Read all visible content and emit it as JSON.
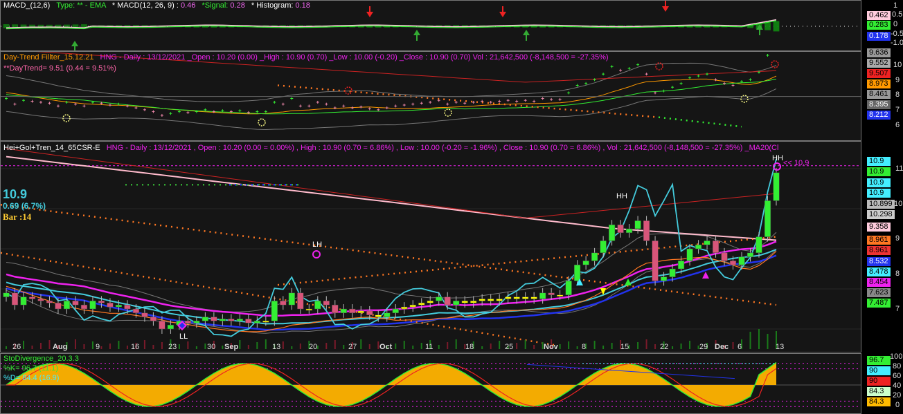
{
  "colors": {
    "up": "#33ee33",
    "down": "#d9557a",
    "neutral": "#ffff00",
    "cyan": "#44ccdd",
    "magenta": "#ee22ee",
    "blue": "#2233ee",
    "pink": "#ffbbcc"
  },
  "macd": {
    "title": "MACD_(12,6)",
    "type_label": "Type: ** - EMA",
    "macd_label": "* MACD(12, 26, 9) :",
    "macd_val": "0.46",
    "signal_label": "*Signal:",
    "signal_val": "0.28",
    "hist_label": "* Histogram:",
    "hist_val": "0.18",
    "axis_ticks": [
      "1",
      "0.5",
      "0",
      "-0.5",
      "-1.0"
    ],
    "tags": [
      "0.462",
      "0.283",
      "0.178"
    ]
  },
  "daytrend": {
    "title": "Day-Trend Fillter_15.12.21",
    "hdr_rest": "HNG - Daily : 13/12/2021 _Open : 10.20 (0.00) _High : 10.90 (0.70) _Low : 10.00 (-0.20) _Close : 10.90 (0.70) Vol : 21,642,500 (-8,148,500 = -27.35%)",
    "dt_label": "**DayTrend= 9.51 (0.44 = 9.51%)",
    "axis_ticks": [
      "10",
      "9",
      "8",
      "7",
      "6"
    ],
    "tags": [
      "9.636",
      "9.552",
      "9.507",
      "8.973",
      "8.461",
      "8.395",
      "8.212"
    ]
  },
  "main": {
    "title": "Hei+Gol+Tren_14_65CSR-E",
    "hdr_rest": "HNG - Daily : 13/12/2021 , Open : 10.20 (0.00 = 0.00%) , High : 10.90 (0.70 = 6.86%) , Low : 10.00 (-0.20 = -1.96%) , Close : 10.90 (0.70 = 6.86%) , Vol : 21,642,500 (-8,148,500 = -27.35%) _MA20(Cl",
    "price_big": "10.9",
    "price_change": "0.69 (6.7%)",
    "bar_count": "Bar :14",
    "axis_ticks": [
      "11",
      "10",
      "9",
      "8",
      "7"
    ],
    "tags": [
      "10.9",
      "10.9",
      "10.9",
      "10.9",
      "10.899",
      "10.298",
      "9.358",
      "8.961",
      "8.961",
      "8.532",
      "8.478",
      "8.454",
      "7.623",
      "7.487"
    ],
    "annotations": {
      "ll": "LL",
      "lh": "LH",
      "hh1": "HH",
      "hh2": "HH",
      "last": "<< 10.9"
    },
    "x_labels": [
      "26",
      "Aug",
      "9",
      "16",
      "23",
      "30",
      "Sep",
      "13",
      "20",
      "27",
      "Oct",
      "11",
      "18",
      "25",
      "Nov",
      "8",
      "15",
      "22",
      "29",
      "Dec",
      "6",
      "13"
    ]
  },
  "sto": {
    "title": "StoDivergence_20.3.3",
    "k_label": "%K= 96.7 (11.1)",
    "d_label": "%D= 84.4 (16.9)",
    "axis_ticks": [
      "100",
      "80",
      "60",
      "40",
      "20",
      "0"
    ],
    "tags": [
      "96.7",
      "90",
      "90",
      "84.3",
      "84.3"
    ]
  },
  "chart_data": {
    "type": "candlestick",
    "symbol": "HNG",
    "interval": "Daily",
    "last": {
      "date": "13/12/2021",
      "open": 10.2,
      "high": 10.9,
      "low": 10.0,
      "close": 10.9,
      "volume": 21642500
    },
    "ylim": [
      6.5,
      11.5
    ],
    "closes": [
      7.9,
      7.6,
      7.8,
      7.75,
      7.7,
      7.65,
      7.5,
      7.7,
      7.6,
      7.5,
      7.7,
      7.65,
      7.55,
      7.6,
      7.5,
      7.4,
      7.3,
      7.2,
      7.0,
      7.1,
      7.2,
      7.15,
      7.2,
      7.3,
      7.2,
      7.25,
      7.2,
      7.25,
      7.15,
      7.2,
      7.2,
      7.7,
      7.6,
      7.9,
      7.5,
      7.5,
      7.7,
      7.6,
      7.4,
      7.5,
      7.4,
      7.45,
      7.35,
      7.3,
      7.4,
      7.5,
      7.55,
      7.6,
      7.65,
      7.7,
      7.8,
      7.6,
      7.7,
      7.65,
      7.7,
      7.75,
      7.7,
      7.75,
      7.8,
      7.75,
      7.8,
      7.75,
      7.9,
      7.85,
      7.85,
      8.2,
      8.6,
      8.7,
      8.9,
      9.2,
      9.6,
      9.4,
      9.5,
      9.7,
      9.2,
      8.2,
      8.3,
      8.5,
      8.7,
      9.0,
      9.1,
      9.2,
      8.9,
      8.7,
      8.6,
      8.8,
      8.9,
      9.3,
      10.2,
      10.9
    ]
  }
}
